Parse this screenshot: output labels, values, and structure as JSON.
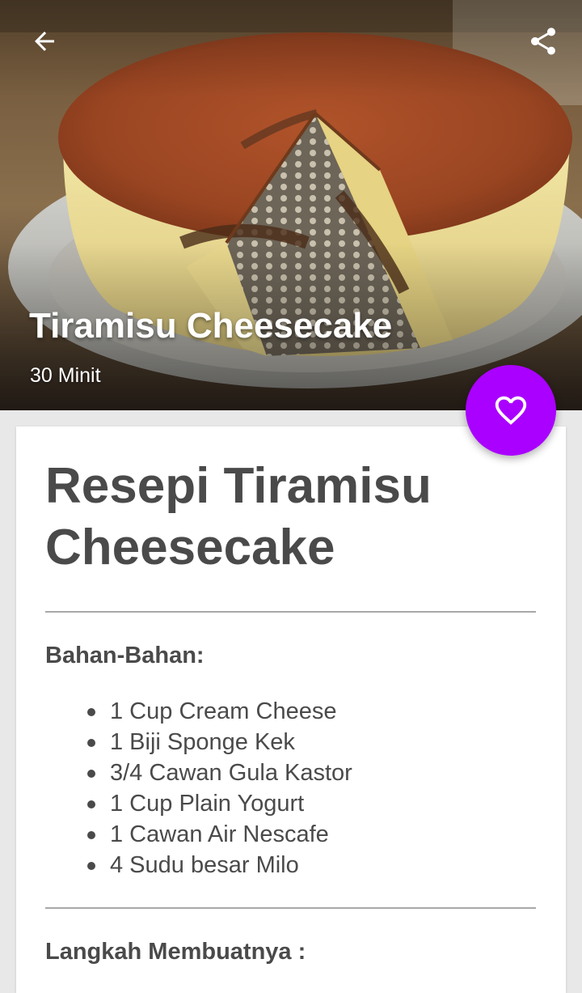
{
  "header": {
    "title": "Tiramisu Cheesecake",
    "duration": "30 Minit",
    "back_icon": "arrow-left-icon",
    "share_icon": "share-icon"
  },
  "favorite": {
    "icon": "heart-icon",
    "color": "#aa00ff"
  },
  "recipe": {
    "title": "Resepi Tiramisu Cheesecake",
    "ingredients_heading": "Bahan-Bahan:",
    "ingredients": [
      "1 Cup Cream Cheese",
      "1 Biji Sponge Kek",
      "3/4 Cawan Gula Kastor",
      "1 Cup Plain Yogurt",
      "1 Cawan Air Nescafe",
      "4 Sudu besar Milo"
    ],
    "steps_heading": "Langkah Membuatnya :"
  }
}
